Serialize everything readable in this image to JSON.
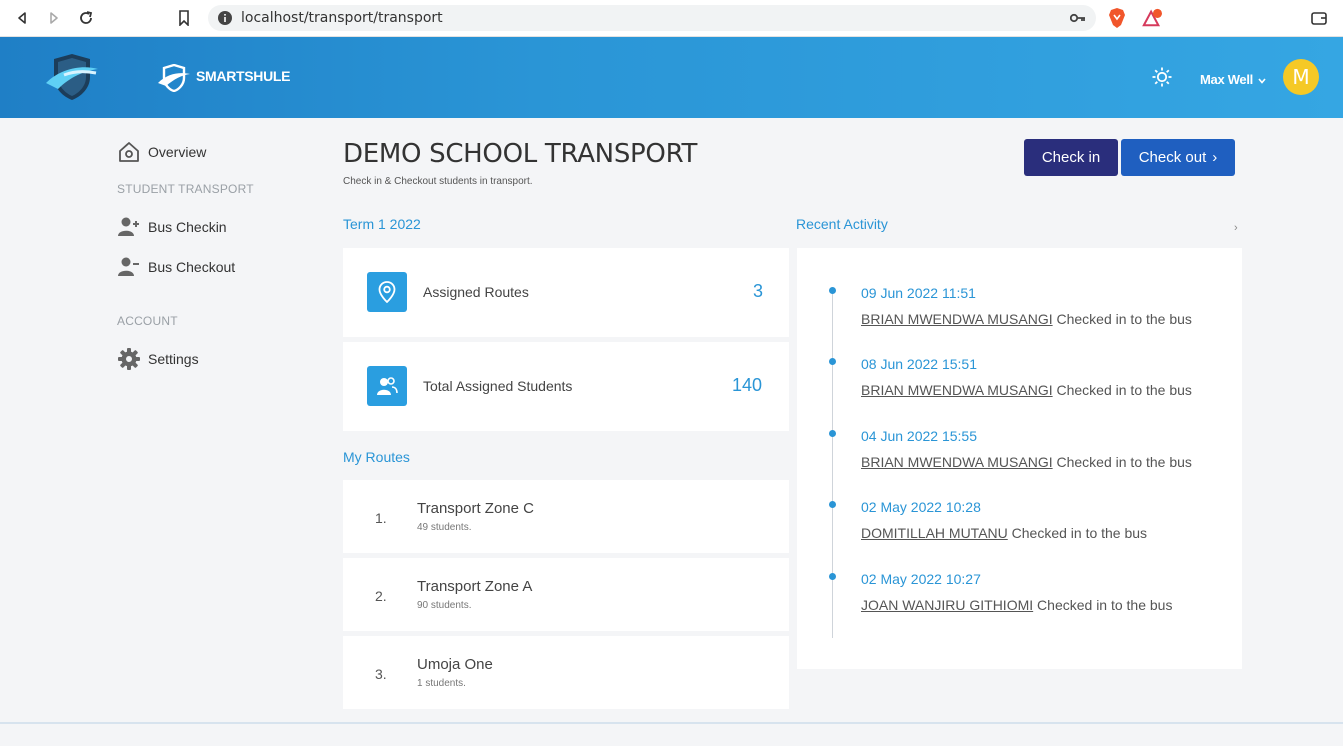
{
  "browser": {
    "url": "localhost/transport/transport"
  },
  "header": {
    "brand": "SMARTSHULE",
    "user_name": "Max Well",
    "avatar_initial": "M"
  },
  "sidebar": {
    "overview": "Overview",
    "section_student_transport": "STUDENT TRANSPORT",
    "bus_checkin": "Bus Checkin",
    "bus_checkout": "Bus Checkout",
    "section_account": "ACCOUNT",
    "settings": "Settings"
  },
  "main": {
    "title": "DEMO SCHOOL TRANSPORT",
    "subtitle": "Check in & Checkout students in transport.",
    "checkin_button": "Check in",
    "checkout_button": "Check out",
    "checkout_chevron": "›",
    "term_label": "Term 1 2022",
    "stats": [
      {
        "label": "Assigned Routes",
        "value": "3"
      },
      {
        "label": "Total Assigned Students",
        "value": "140"
      }
    ],
    "my_routes_label": "My Routes",
    "routes": [
      {
        "num": "1.",
        "name": "Transport Zone C",
        "students": "49 students."
      },
      {
        "num": "2.",
        "name": "Transport Zone A",
        "students": "90 students."
      },
      {
        "num": "3.",
        "name": "Umoja One",
        "students": "1 students."
      }
    ]
  },
  "activity": {
    "label": "Recent Activity",
    "more": "›",
    "items": [
      {
        "date": "09 Jun 2022 11:51",
        "name": "BRIAN MWENDWA MUSANGI",
        "action": " Checked in to the bus"
      },
      {
        "date": "08 Jun 2022 15:51",
        "name": "BRIAN MWENDWA MUSANGI",
        "action": " Checked in to the bus"
      },
      {
        "date": "04 Jun 2022 15:55",
        "name": "BRIAN MWENDWA MUSANGI",
        "action": " Checked in to the bus"
      },
      {
        "date": "02 May 2022 10:28",
        "name": "DOMITILLAH MUTANU",
        "action": " Checked in to the bus"
      },
      {
        "date": "02 May 2022 10:27",
        "name": "JOAN WANJIRU GITHIOMI",
        "action": " Checked in to the bus"
      }
    ]
  },
  "colors": {
    "accent": "#2a95d6",
    "checkin": "#2a2e7c",
    "checkout": "#1f5fc0",
    "avatar": "#f5c926"
  },
  "icons": {
    "overview": "home-icon",
    "bus_checkin": "user-plus-icon",
    "bus_checkout": "user-minus-icon",
    "settings": "gear-icon",
    "routes": "map-pin-icon",
    "students": "users-icon",
    "theme": "sun-icon"
  }
}
